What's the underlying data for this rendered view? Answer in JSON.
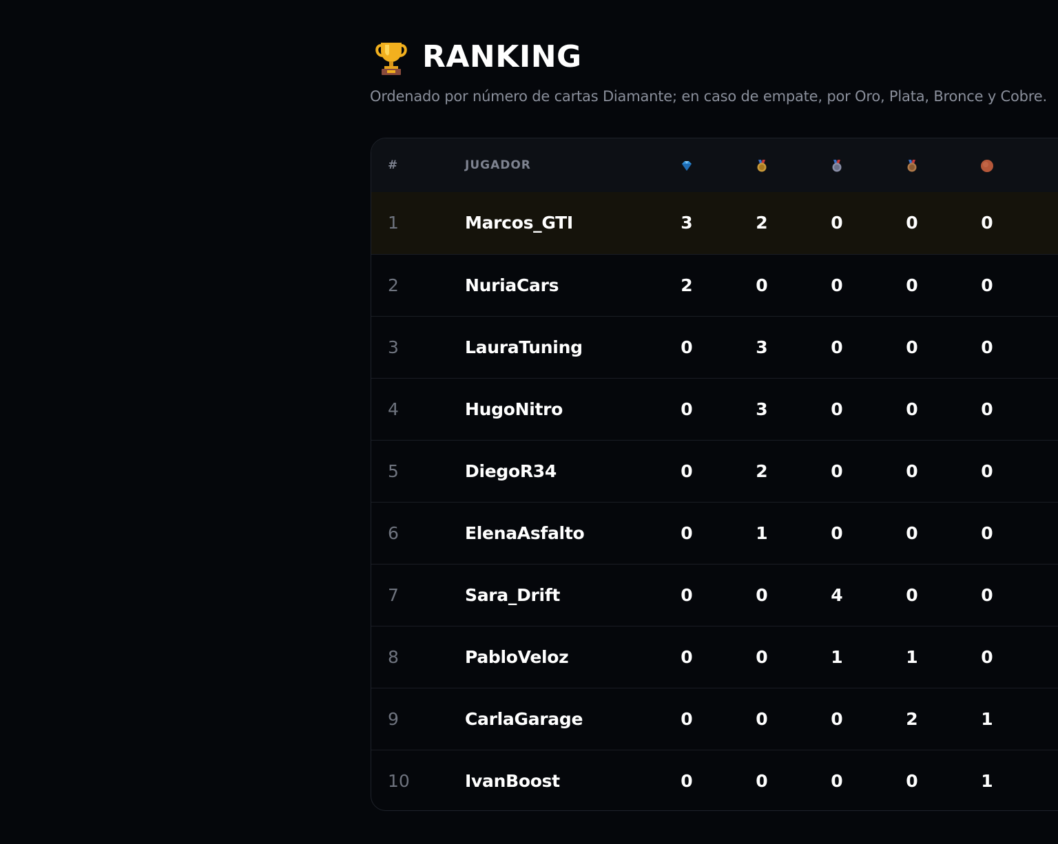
{
  "header": {
    "title": "RANKING",
    "title_icon": "trophy-icon",
    "subtitle": "Ordenado por número de cartas Diamante; en caso de empate, por Oro, Plata, Bronce y Cobre."
  },
  "table": {
    "columns": {
      "rank": "#",
      "player": "JUGADOR",
      "diamond_icon": "diamond-icon",
      "gold_icon": "gold-medal-icon",
      "silver_icon": "silver-medal-icon",
      "bronze_icon": "bronze-medal-icon",
      "copper_icon": "copper-coin-icon"
    },
    "colors": {
      "diamond": "#2f8fd8",
      "gold": "#c99a3a",
      "silver": "#8a8fa8",
      "bronze": "#b07a4a",
      "copper": "#b5583a",
      "highlight_row": "#15130b"
    },
    "rows": [
      {
        "rank": "1",
        "player": "Marcos_GTI",
        "diamond": "3",
        "gold": "2",
        "silver": "0",
        "bronze": "0",
        "copper": "0"
      },
      {
        "rank": "2",
        "player": "NuriaCars",
        "diamond": "2",
        "gold": "0",
        "silver": "0",
        "bronze": "0",
        "copper": "0"
      },
      {
        "rank": "3",
        "player": "LauraTuning",
        "diamond": "0",
        "gold": "3",
        "silver": "0",
        "bronze": "0",
        "copper": "0"
      },
      {
        "rank": "4",
        "player": "HugoNitro",
        "diamond": "0",
        "gold": "3",
        "silver": "0",
        "bronze": "0",
        "copper": "0"
      },
      {
        "rank": "5",
        "player": "DiegoR34",
        "diamond": "0",
        "gold": "2",
        "silver": "0",
        "bronze": "0",
        "copper": "0"
      },
      {
        "rank": "6",
        "player": "ElenaAsfalto",
        "diamond": "0",
        "gold": "1",
        "silver": "0",
        "bronze": "0",
        "copper": "0"
      },
      {
        "rank": "7",
        "player": "Sara_Drift",
        "diamond": "0",
        "gold": "0",
        "silver": "4",
        "bronze": "0",
        "copper": "0"
      },
      {
        "rank": "8",
        "player": "PabloVeloz",
        "diamond": "0",
        "gold": "0",
        "silver": "1",
        "bronze": "1",
        "copper": "0"
      },
      {
        "rank": "9",
        "player": "CarlaGarage",
        "diamond": "0",
        "gold": "0",
        "silver": "0",
        "bronze": "2",
        "copper": "1"
      },
      {
        "rank": "10",
        "player": "IvanBoost",
        "diamond": "0",
        "gold": "0",
        "silver": "0",
        "bronze": "0",
        "copper": "1"
      }
    ]
  }
}
